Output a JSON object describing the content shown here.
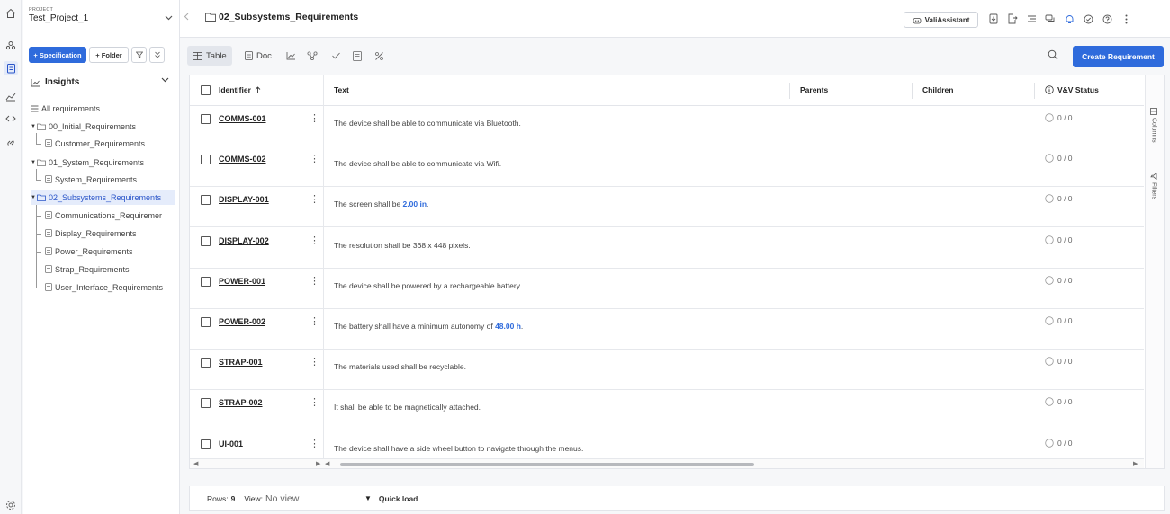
{
  "project": {
    "label": "PROJECT",
    "name": "Test_Project_1"
  },
  "sidebar_actions": {
    "specification": "+ Specification",
    "folder": "+ Folder"
  },
  "insights": {
    "label": "Insights"
  },
  "tree": {
    "all": "All requirements",
    "items": [
      {
        "label": "00_Initial_Requirements",
        "type": "folder"
      },
      {
        "label": "Customer_Requirements",
        "type": "spec"
      },
      {
        "label": "01_System_Requirements",
        "type": "folder"
      },
      {
        "label": "System_Requirements",
        "type": "spec"
      },
      {
        "label": "02_Subsystems_Requirements",
        "type": "folder"
      },
      {
        "label": "Communications_Requiremer",
        "type": "spec"
      },
      {
        "label": "Display_Requirements",
        "type": "spec"
      },
      {
        "label": "Power_Requirements",
        "type": "spec"
      },
      {
        "label": "Strap_Requirements",
        "type": "spec"
      },
      {
        "label": "User_Interface_Requirements",
        "type": "spec"
      }
    ]
  },
  "header": {
    "breadcrumb": "02_Subsystems_Requirements",
    "assistant": "ValiAssistant"
  },
  "toolbar": {
    "table": "Table",
    "doc": "Doc",
    "create": "Create Requirement"
  },
  "columns": {
    "identifier": "Identifier",
    "text": "Text",
    "parents": "Parents",
    "children": "Children",
    "vv": "V&V Status"
  },
  "rows": [
    {
      "id": "COMMS-001",
      "text": "The device shall be able to communicate via Bluetooth.",
      "qty": "",
      "post": "",
      "vv": "0 / 0"
    },
    {
      "id": "COMMS-002",
      "text": "The device shall be able to communicate via Wifi.",
      "qty": "",
      "post": "",
      "vv": "0 / 0"
    },
    {
      "id": "DISPLAY-001",
      "text": "The screen shall be ",
      "qty": "2.00  in",
      "post": ".",
      "vv": "0 / 0"
    },
    {
      "id": "DISPLAY-002",
      "text": "The resolution shall be 368 x 448 pixels.",
      "qty": "",
      "post": "",
      "vv": "0 / 0"
    },
    {
      "id": "POWER-001",
      "text": "The device shall be powered by a rechargeable battery.",
      "qty": "",
      "post": "",
      "vv": "0 / 0"
    },
    {
      "id": "POWER-002",
      "text": "The battery shall have a minimum autonomy of ",
      "qty": "48.00  h",
      "post": ".",
      "vv": "0 / 0"
    },
    {
      "id": "STRAP-001",
      "text": "The materials used shall be recyclable.",
      "qty": "",
      "post": "",
      "vv": "0 / 0"
    },
    {
      "id": "STRAP-002",
      "text": "It shall be able to be magnetically attached.",
      "qty": "",
      "post": "",
      "vv": "0 / 0"
    },
    {
      "id": "UI-001",
      "text": "The device shall have a side wheel button to navigate through the menus.",
      "qty": "",
      "post": "",
      "vv": "0 / 0"
    }
  ],
  "side_panel": {
    "columns": "Columns",
    "filters": "Filters"
  },
  "footer": {
    "rows_label": "Rows:",
    "rows_value": "9",
    "view_label": "View:",
    "view_value": "No view",
    "quick_load": "Quick load"
  },
  "colors": {
    "accent": "#2f6bdc",
    "selected_bg": "#e5ecfb"
  }
}
